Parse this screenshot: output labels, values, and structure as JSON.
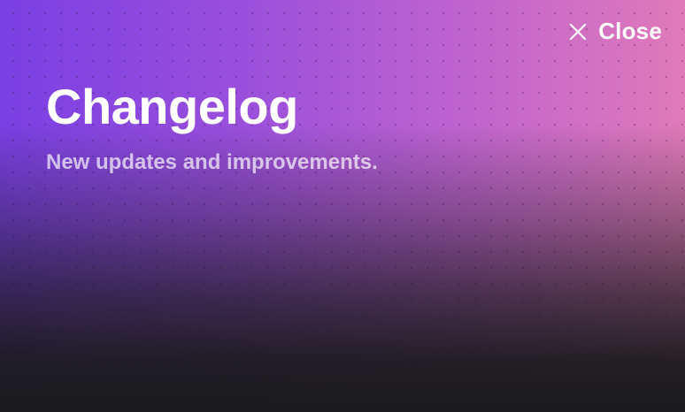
{
  "close_button": {
    "label": "Close",
    "icon": "close-icon"
  },
  "header": {
    "title": "Changelog",
    "subtitle": "New updates and improvements."
  },
  "colors": {
    "gradient_start": "#7a3fe3",
    "gradient_mid": "#c064cf",
    "gradient_end": "#e07ab9",
    "background_dark": "#1a1a1c",
    "text_primary": "#ffffff"
  }
}
